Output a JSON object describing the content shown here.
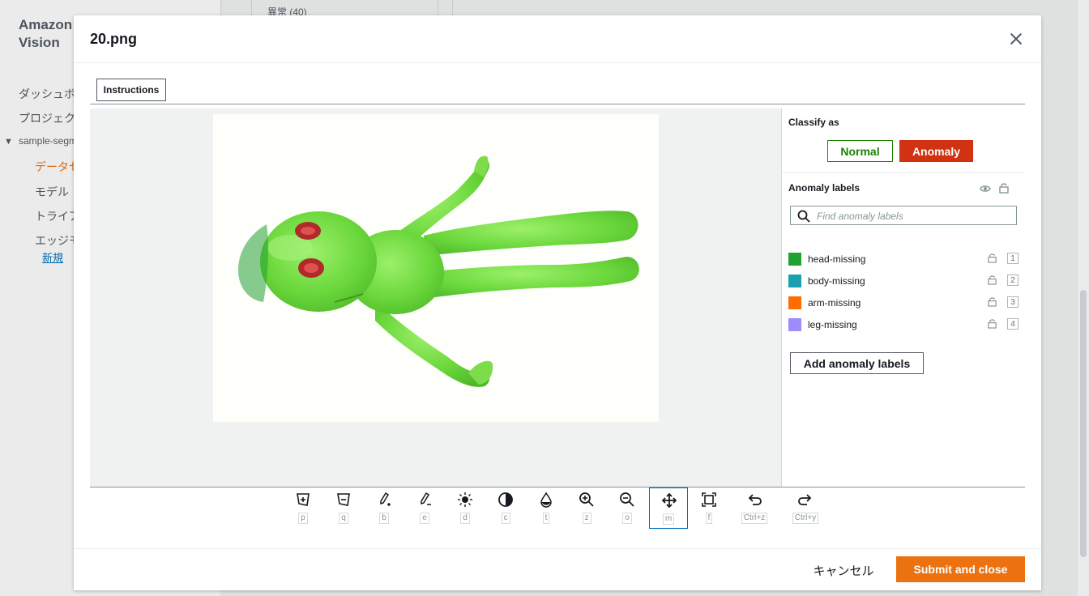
{
  "background": {
    "brand": "Amazon Lookout for Vision",
    "brand_line1": "Amazon",
    "brand_line2": "Vision",
    "top_text": "異常 (40)",
    "nav": [
      "ダッシュボード",
      "プロジェクト",
      "sample-segmentation",
      "データセット",
      "モデル",
      "トライアル",
      "エッジモデル",
      "新規"
    ]
  },
  "modal": {
    "title": "20.png",
    "instructions_label": "Instructions",
    "classify": {
      "title": "Classify as",
      "normal_label": "Normal",
      "anomaly_label": "Anomaly",
      "selected": "Anomaly"
    },
    "anomaly_labels": {
      "title": "Anomaly labels",
      "search_placeholder": "Find anomaly labels",
      "items": [
        {
          "name": "head-missing",
          "color": "#22a133",
          "key": "1"
        },
        {
          "name": "body-missing",
          "color": "#1aa0ae",
          "key": "2"
        },
        {
          "name": "arm-missing",
          "color": "#ff6d00",
          "key": "3"
        },
        {
          "name": "leg-missing",
          "color": "#9c8cfc",
          "key": "4"
        }
      ],
      "add_label": "Add anomaly labels"
    },
    "toolbar": [
      {
        "name": "polygon-add-tool",
        "icon": "polygon-plus-icon",
        "key": "p"
      },
      {
        "name": "polygon-subtract-tool",
        "icon": "polygon-minus-icon",
        "key": "q"
      },
      {
        "name": "brush-tool",
        "icon": "brush-icon",
        "key": "b"
      },
      {
        "name": "eraser-tool",
        "icon": "eraser-icon",
        "key": "e"
      },
      {
        "name": "brightness-tool",
        "icon": "sun-icon",
        "key": "d"
      },
      {
        "name": "contrast-tool",
        "icon": "contrast-icon",
        "key": "c"
      },
      {
        "name": "transparency-tool",
        "icon": "drop-icon",
        "key": "t"
      },
      {
        "name": "zoom-in-tool",
        "icon": "zoom-in-icon",
        "key": "z"
      },
      {
        "name": "zoom-out-tool",
        "icon": "zoom-out-icon",
        "key": "o"
      },
      {
        "name": "move-tool",
        "icon": "move-icon",
        "key": "m",
        "active": true
      },
      {
        "name": "fit-tool",
        "icon": "fit-icon",
        "key": "f"
      },
      {
        "name": "undo-tool",
        "icon": "undo-icon",
        "key": "Ctrl+z"
      },
      {
        "name": "redo-tool",
        "icon": "redo-icon",
        "key": "Ctrl+y"
      }
    ],
    "cancel_label": "キャンセル",
    "submit_label": "Submit and close"
  }
}
